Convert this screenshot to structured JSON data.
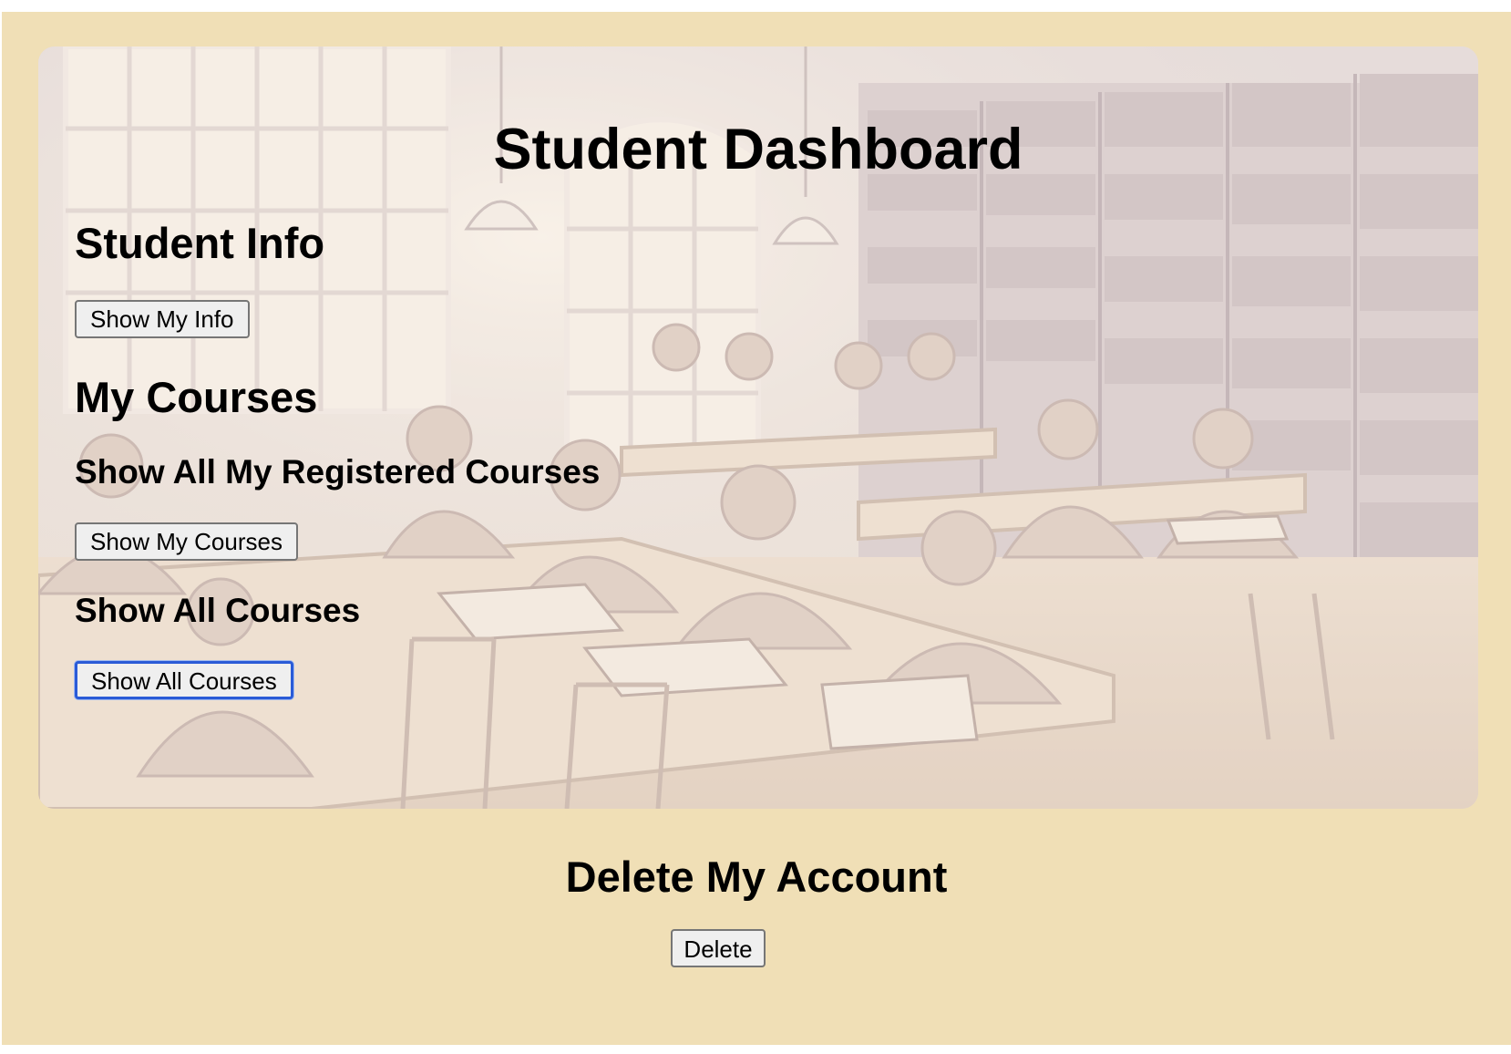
{
  "dashboard": {
    "title": "Student Dashboard"
  },
  "student_info": {
    "heading": "Student Info",
    "button_label": "Show My Info"
  },
  "my_courses": {
    "heading": "My Courses",
    "registered": {
      "heading": "Show All My Registered Courses",
      "button_label": "Show My Courses"
    },
    "all": {
      "heading": "Show All Courses",
      "button_label": "Show All Courses"
    }
  },
  "delete_account": {
    "heading": "Delete My Account",
    "button_label": "Delete"
  },
  "colors": {
    "page_background": "#f0dfb6",
    "button_background": "#efefef",
    "button_border": "#767676",
    "focus_ring": "#2a5bd7"
  },
  "background_image": {
    "subject": "library study hall illustration"
  }
}
